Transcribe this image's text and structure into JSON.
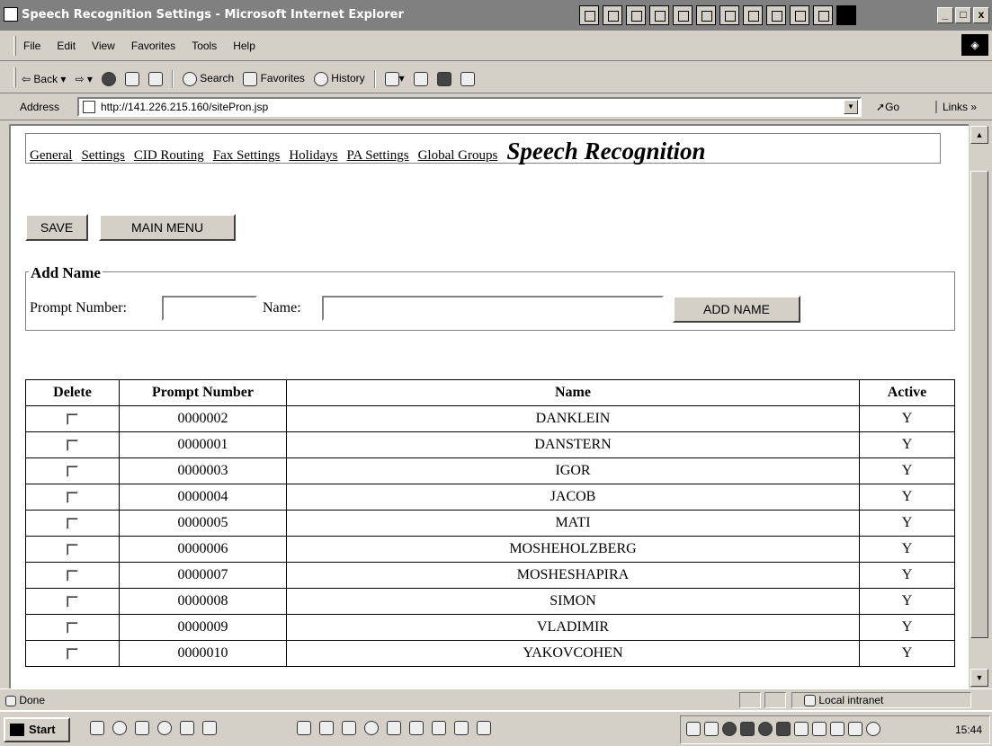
{
  "window": {
    "title": "Speech Recognition Settings - Microsoft Internet Explorer"
  },
  "menu": [
    "File",
    "Edit",
    "View",
    "Favorites",
    "Tools",
    "Help"
  ],
  "toolbar": {
    "back": "Back",
    "search": "Search",
    "favorites": "Favorites",
    "history": "History"
  },
  "address": {
    "label": "Address",
    "url": "http://141.226.215.160/sitePron.jsp",
    "go": "Go",
    "links": "Links »"
  },
  "nav": {
    "links": [
      "General",
      "Settings",
      "CID Routing",
      "Fax Settings",
      "Holidays",
      "PA Settings",
      "Global Groups"
    ],
    "current": "Speech Recognition"
  },
  "buttons": {
    "save": "SAVE",
    "main_menu": "MAIN MENU",
    "add_name": "ADD NAME"
  },
  "add_name": {
    "legend": "Add Name",
    "prompt_label": "Prompt Number:",
    "name_label": "Name:",
    "prompt_value": "",
    "name_value": ""
  },
  "table": {
    "headers": [
      "Delete",
      "Prompt Number",
      "Name",
      "Active"
    ],
    "rows": [
      {
        "prompt": "0000002",
        "name": "DANKLEIN",
        "active": "Y",
        "checked": false
      },
      {
        "prompt": "0000001",
        "name": "DANSTERN",
        "active": "Y",
        "checked": false
      },
      {
        "prompt": "0000003",
        "name": "IGOR",
        "active": "Y",
        "checked": false
      },
      {
        "prompt": "0000004",
        "name": "JACOB",
        "active": "Y",
        "checked": false
      },
      {
        "prompt": "0000005",
        "name": "MATI",
        "active": "Y",
        "checked": false
      },
      {
        "prompt": "0000006",
        "name": "MOSHEHOLZBERG",
        "active": "Y",
        "checked": false
      },
      {
        "prompt": "0000007",
        "name": "MOSHESHAPIRA",
        "active": "Y",
        "checked": false
      },
      {
        "prompt": "0000008",
        "name": "SIMON",
        "active": "Y",
        "checked": false
      },
      {
        "prompt": "0000009",
        "name": "VLADIMIR",
        "active": "Y",
        "checked": false
      },
      {
        "prompt": "0000010",
        "name": "YAKOVCOHEN",
        "active": "Y",
        "checked": false
      }
    ]
  },
  "status": {
    "text": "Done",
    "zone": "Local intranet"
  },
  "taskbar": {
    "start": "Start",
    "clock": "15:44"
  }
}
